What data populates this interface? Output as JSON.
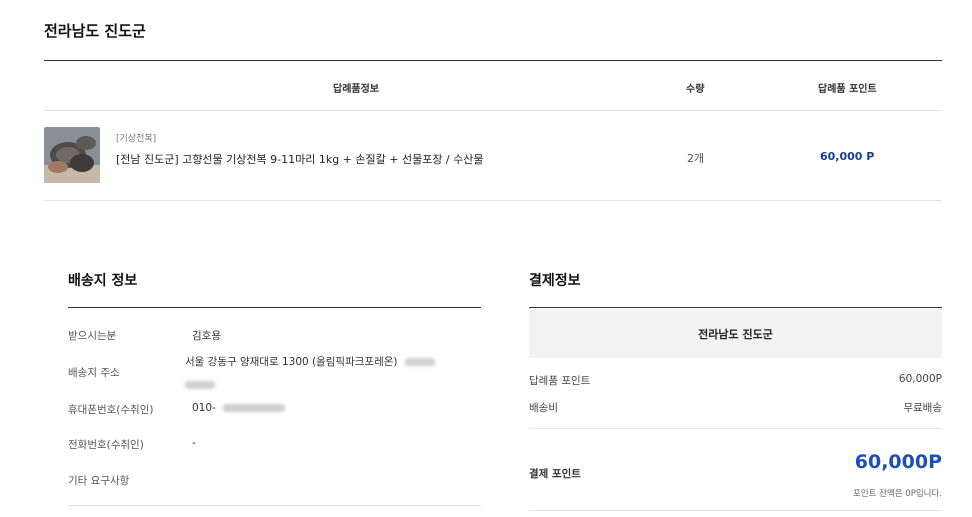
{
  "page_title": "전라남도 진도군",
  "order_table": {
    "headers": {
      "product_info": "답례품정보",
      "quantity": "수량",
      "points": "답례품 포인트"
    },
    "item": {
      "category": "[기상전복]",
      "name": "[전남 진도군] 고향선물 기상전복 9-11마리 1kg + 손질칼 + 선물포장 / 수산물",
      "quantity": "2개",
      "points": "60,000 P"
    }
  },
  "shipping": {
    "title": "배송지 정보",
    "rows": [
      {
        "label": "받으시는분",
        "value": "김호용"
      },
      {
        "label": "배송지 주소",
        "value": "서울 강동구 양재대로 1300 (올림픽파크포레온)"
      },
      {
        "label": "휴대폰번호(수취인)",
        "value": "010-"
      },
      {
        "label": "전화번호(수취인)",
        "value": "-"
      },
      {
        "label": "기타 요구사항",
        "value": ""
      }
    ]
  },
  "payment": {
    "title": "결제정보",
    "header": "전라남도 진도군",
    "rows": [
      {
        "label": "답례품 포인트",
        "value": "60,000P"
      },
      {
        "label": "배송비",
        "value": "무료배송"
      }
    ],
    "total_label": "결제 포인트",
    "total_value": "60,000P",
    "balance_note": "포인트 잔액은 0P입니다."
  }
}
